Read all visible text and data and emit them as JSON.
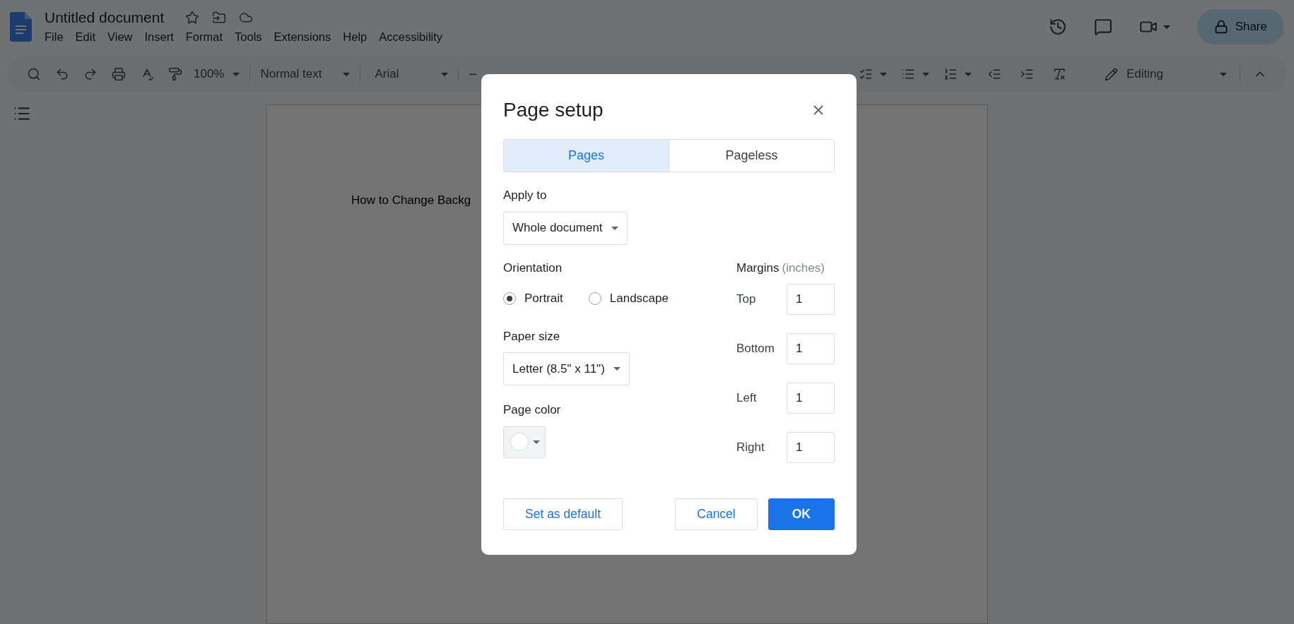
{
  "app": {
    "title": "Untitled document",
    "menu": [
      {
        "label": "File"
      },
      {
        "label": "Edit"
      },
      {
        "label": "View"
      },
      {
        "label": "Insert"
      },
      {
        "label": "Format"
      },
      {
        "label": "Tools"
      },
      {
        "label": "Extensions"
      },
      {
        "label": "Help"
      },
      {
        "label": "Accessibility"
      }
    ],
    "share": "Share"
  },
  "toolbar": {
    "zoom": "100%",
    "style": "Normal text",
    "font": "Arial",
    "decrease": "−",
    "mode": "Editing"
  },
  "document": {
    "text": "How to Change Backg"
  },
  "dialog": {
    "title": "Page setup",
    "tabs": [
      {
        "label": "Pages",
        "selected": true
      },
      {
        "label": "Pageless",
        "selected": false
      }
    ],
    "apply_to": {
      "label": "Apply to",
      "value": "Whole document"
    },
    "orientation": {
      "label": "Orientation",
      "options": [
        {
          "label": "Portrait",
          "selected": true
        },
        {
          "label": "Landscape",
          "selected": false
        }
      ]
    },
    "paper_size": {
      "label": "Paper size",
      "value": "Letter (8.5\" x 11\")"
    },
    "page_color": {
      "label": "Page color",
      "color": "#ffffff"
    },
    "margins": {
      "label": "Margins",
      "unit": "(inches)",
      "fields": [
        {
          "label": "Top",
          "value": "1"
        },
        {
          "label": "Bottom",
          "value": "1"
        },
        {
          "label": "Left",
          "value": "1"
        },
        {
          "label": "Right",
          "value": "1"
        }
      ]
    },
    "buttons": [
      {
        "label": "Set as default",
        "kind": "secondary"
      },
      {
        "label": "Cancel",
        "kind": "secondary"
      },
      {
        "label": "OK",
        "kind": "primary"
      }
    ]
  }
}
